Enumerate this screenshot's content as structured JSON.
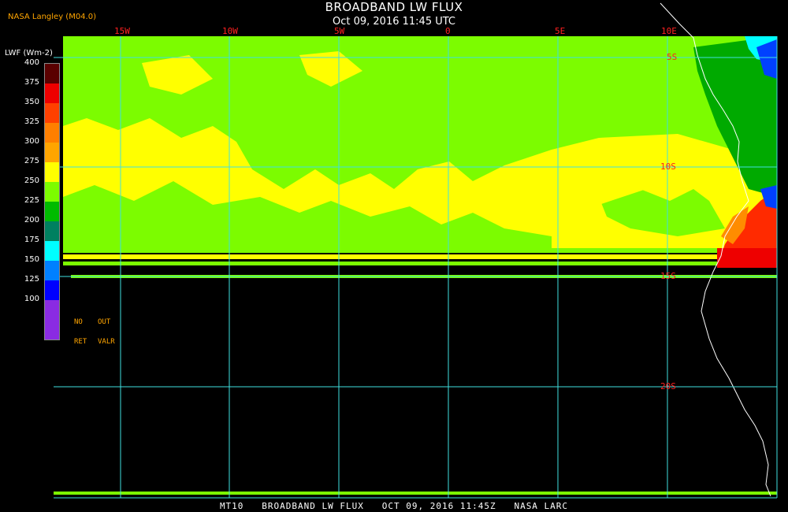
{
  "header": {
    "title": "BROADBAND LW FLUX",
    "subtitle": "Oct 09, 2016 11:45 UTC",
    "source": "NASA Langley (M04.0)"
  },
  "legend": {
    "title": "LWF (Wm-2)",
    "scale_labels": [
      "400",
      "375",
      "350",
      "325",
      "300",
      "275",
      "250",
      "225",
      "200",
      "175",
      "150",
      "125",
      "100"
    ],
    "colors": [
      "#5a0000",
      "#ee0000",
      "#ff4000",
      "#ff7f00",
      "#ffa500",
      "#ffff00",
      "#7cfc00",
      "#00bb00",
      "#008060",
      "#00ffff",
      "#0080ff",
      "#0000ff",
      "#8a2be2"
    ],
    "no_ret": [
      "NO",
      "RET"
    ],
    "out_valr": [
      "OUT",
      "VALR"
    ]
  },
  "grid": {
    "longitudes": [
      "15W",
      "10W",
      "5W",
      "0",
      "5E",
      "10E"
    ],
    "latitudes": [
      "5S",
      "10S",
      "15S",
      "20S"
    ]
  },
  "footer": "MT10   BROADBAND LW FLUX   OCT 09, 2016 11:45Z   NASA LARC",
  "field_colors": {
    "yellow": "#ffff00",
    "green": "#7cfc00",
    "dark_green": "#00aa00",
    "red": "#ff2a00",
    "cyan": "#00ffff",
    "grid": "#40e0e0",
    "coast": "#ffffff"
  }
}
